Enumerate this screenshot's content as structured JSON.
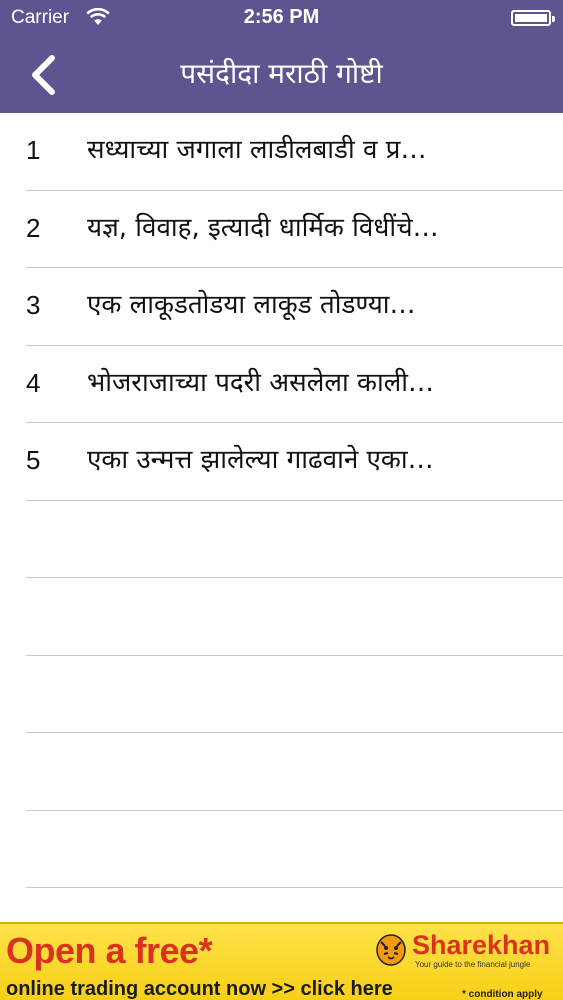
{
  "status_bar": {
    "carrier": "Carrier",
    "time": "2:56 PM"
  },
  "nav": {
    "title": "पसंदीदा मराठी गोष्टी",
    "back_icon": "chevron-left-icon"
  },
  "stories": [
    {
      "num": "1",
      "title": "सध्याच्या जगाला लाडीलबाडी व प्र…"
    },
    {
      "num": "2",
      "title": "यज्ञ, विवाह, इत्यादी धार्मिक विधींचे…"
    },
    {
      "num": "3",
      "title": "एक लाकूडतोडया लाकूड तोडण्या…"
    },
    {
      "num": "4",
      "title": "भोजराजाच्या पदरी असलेला काली…"
    },
    {
      "num": "5",
      "title": "एका उन्मत्त झालेल्या गाढवाने एका…"
    }
  ],
  "ad": {
    "headline": "Open a free*",
    "subline": "online trading account now >> click here",
    "brand": "Sharekhan",
    "tagline": "Your guide to the financial jungle",
    "note": "* condition apply"
  },
  "colors": {
    "nav_background": "#5d5590",
    "separator": "#c8c7cc",
    "ad_background": "#f7cf16",
    "ad_accent": "#d9331f"
  }
}
